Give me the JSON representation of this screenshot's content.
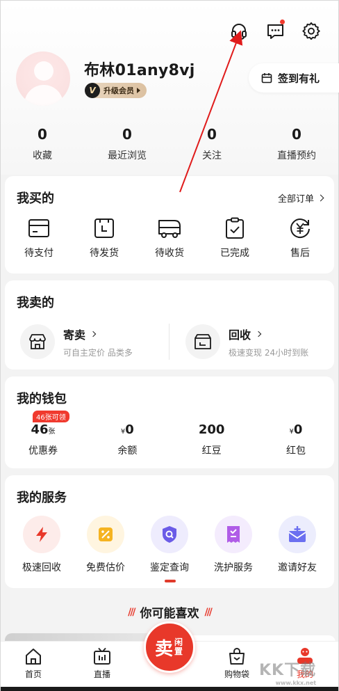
{
  "header": {
    "icons": [
      "headset-icon",
      "message-icon",
      "gear-icon"
    ],
    "has_message_dot": true
  },
  "profile": {
    "username": "布林01any8vj",
    "vip_badge_letter": "V",
    "vip_label": "升级会员",
    "signin_label": "签到有礼"
  },
  "stats": [
    {
      "value": "0",
      "label": "收藏"
    },
    {
      "value": "0",
      "label": "最近浏览"
    },
    {
      "value": "0",
      "label": "关注"
    },
    {
      "value": "0",
      "label": "直播预约"
    }
  ],
  "buy": {
    "title": "我买的",
    "link": "全部订单",
    "items": [
      {
        "label": "待支付",
        "icon": "wallet-icon"
      },
      {
        "label": "待发货",
        "icon": "package-clock-icon"
      },
      {
        "label": "待收货",
        "icon": "truck-icon"
      },
      {
        "label": "已完成",
        "icon": "clipboard-check-icon"
      },
      {
        "label": "售后",
        "icon": "yen-refresh-icon"
      }
    ]
  },
  "sell": {
    "title": "我卖的",
    "items": [
      {
        "title": "寄卖",
        "subtitle": "可自主定价 品类多",
        "icon": "shop-icon"
      },
      {
        "title": "回收",
        "subtitle": "极速变现 24小时到账",
        "icon": "box-icon"
      }
    ]
  },
  "wallet": {
    "title": "我的钱包",
    "coupon_tag": "46张可领",
    "items": [
      {
        "value": "46",
        "unit": "张",
        "prefix": "",
        "label": "优惠券"
      },
      {
        "value": "0",
        "unit": "",
        "prefix": "¥",
        "label": "余额"
      },
      {
        "value": "200",
        "unit": "",
        "prefix": "",
        "label": "红豆"
      },
      {
        "value": "0",
        "unit": "",
        "prefix": "¥",
        "label": "红包"
      }
    ]
  },
  "services": {
    "title": "我的服务",
    "items": [
      {
        "label": "极速回收",
        "icon": "lightning-icon",
        "color": "#e8382a",
        "bg": "#fdecea"
      },
      {
        "label": "免费估价",
        "icon": "percent-tag-icon",
        "color": "#f5b321",
        "bg": "#fff5e0"
      },
      {
        "label": "鉴定查询",
        "icon": "shield-search-icon",
        "color": "#6b5ce7",
        "bg": "#eeecfd"
      },
      {
        "label": "洗护服务",
        "icon": "receipt-icon",
        "color": "#b05ce7",
        "bg": "#f4ecfd"
      },
      {
        "label": "邀请好友",
        "icon": "invite-mail-icon",
        "color": "#6b6ff0",
        "bg": "#ecedfd"
      }
    ]
  },
  "recommend": {
    "title": "你可能喜欢"
  },
  "tabbar": {
    "items": [
      {
        "label": "首页",
        "icon": "home-icon"
      },
      {
        "label": "直播",
        "icon": "tv-icon"
      },
      {
        "label": "购物袋",
        "icon": "bag-icon"
      },
      {
        "label": "我的",
        "icon": "me-icon"
      }
    ],
    "sell_fab_big": "卖",
    "sell_fab_small": "闲置"
  },
  "watermark": {
    "text": "KK下载",
    "sub": "www.kkx.net"
  },
  "colors": {
    "accent": "#e8382a",
    "annotation_arrow": "#e01b1b"
  }
}
